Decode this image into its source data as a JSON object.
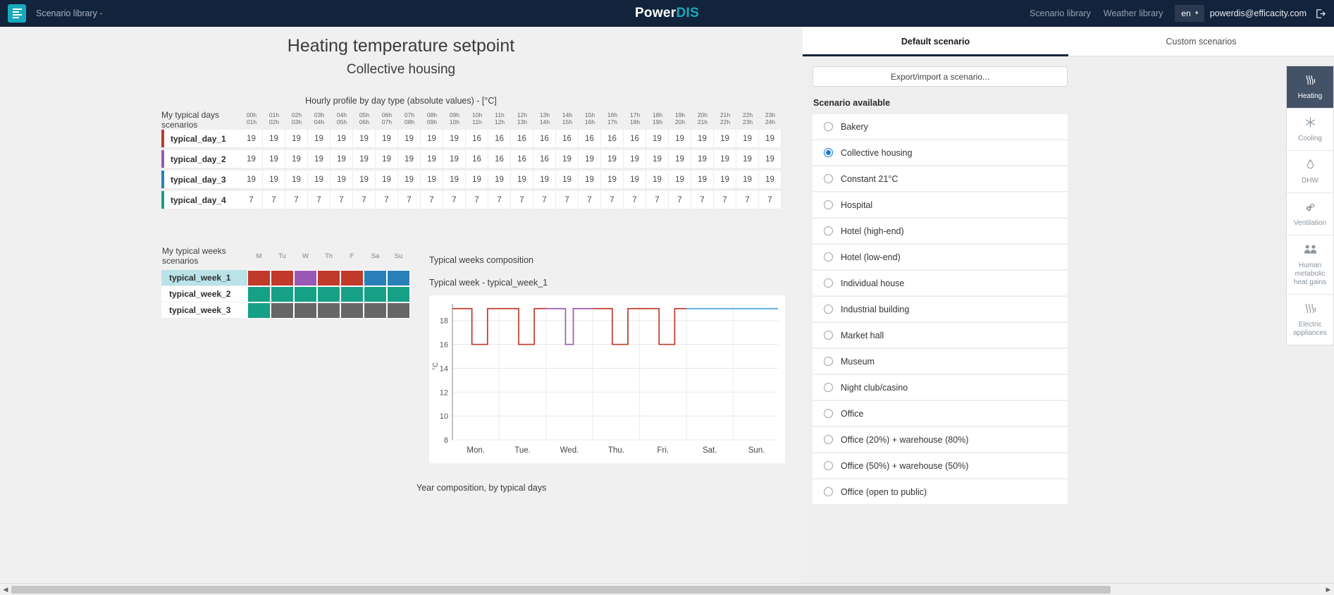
{
  "topbar": {
    "menu_icon": "hamburger-icon",
    "breadcrumb": "Scenario library -",
    "logo_part1": "Power",
    "logo_part2": "DIS",
    "links": [
      "Scenario library",
      "Weather library"
    ],
    "language": "en",
    "user_email": "powerdis@efficacity.com",
    "logout_icon": "logout-icon"
  },
  "main": {
    "title": "Heating temperature setpoint",
    "subtitle": "Collective housing",
    "hourly_title": "Hourly profile by day type (absolute values) - [°C]",
    "days_header_label": "My typical days scenarios",
    "hour_columns": [
      {
        "from": "00h",
        "to": "01h"
      },
      {
        "from": "01h",
        "to": "02h"
      },
      {
        "from": "02h",
        "to": "03h"
      },
      {
        "from": "03h",
        "to": "04h"
      },
      {
        "from": "04h",
        "to": "05h"
      },
      {
        "from": "05h",
        "to": "06h"
      },
      {
        "from": "06h",
        "to": "07h"
      },
      {
        "from": "07h",
        "to": "08h"
      },
      {
        "from": "08h",
        "to": "09h"
      },
      {
        "from": "09h",
        "to": "10h"
      },
      {
        "from": "10h",
        "to": "11h"
      },
      {
        "from": "11h",
        "to": "12h"
      },
      {
        "from": "12h",
        "to": "13h"
      },
      {
        "from": "13h",
        "to": "14h"
      },
      {
        "from": "14h",
        "to": "15h"
      },
      {
        "from": "15h",
        "to": "16h"
      },
      {
        "from": "16h",
        "to": "17h"
      },
      {
        "from": "17h",
        "to": "18h"
      },
      {
        "from": "18h",
        "to": "19h"
      },
      {
        "from": "19h",
        "to": "20h"
      },
      {
        "from": "20h",
        "to": "21h"
      },
      {
        "from": "21h",
        "to": "22h"
      },
      {
        "from": "22h",
        "to": "23h"
      },
      {
        "from": "23h",
        "to": "24h"
      }
    ],
    "day_rows": [
      {
        "name": "typical_day_1",
        "color": "#c0392b",
        "values": [
          19,
          19,
          19,
          19,
          19,
          19,
          19,
          19,
          19,
          19,
          16,
          16,
          16,
          16,
          16,
          16,
          16,
          16,
          19,
          19,
          19,
          19,
          19,
          19
        ]
      },
      {
        "name": "typical_day_2",
        "color": "#9b59b6",
        "values": [
          19,
          19,
          19,
          19,
          19,
          19,
          19,
          19,
          19,
          19,
          16,
          16,
          16,
          16,
          19,
          19,
          19,
          19,
          19,
          19,
          19,
          19,
          19,
          19
        ]
      },
      {
        "name": "typical_day_3",
        "color": "#2980b9",
        "values": [
          19,
          19,
          19,
          19,
          19,
          19,
          19,
          19,
          19,
          19,
          19,
          19,
          19,
          19,
          19,
          19,
          19,
          19,
          19,
          19,
          19,
          19,
          19,
          19
        ]
      },
      {
        "name": "typical_day_4",
        "color": "#16a085",
        "values": [
          7,
          7,
          7,
          7,
          7,
          7,
          7,
          7,
          7,
          7,
          7,
          7,
          7,
          7,
          7,
          7,
          7,
          7,
          7,
          7,
          7,
          7,
          7,
          7
        ]
      }
    ],
    "weeks_header_label": "My typical weeks scenarios",
    "dow_headers": [
      "M",
      "Tu",
      "W",
      "Th",
      "F",
      "Sa",
      "Su"
    ],
    "week_rows": [
      {
        "name": "typical_week_1",
        "selected": true,
        "colors": [
          "#c0392b",
          "#c0392b",
          "#9b59b6",
          "#c0392b",
          "#c0392b",
          "#2980b9",
          "#2980b9"
        ]
      },
      {
        "name": "typical_week_2",
        "selected": false,
        "colors": [
          "#16a085",
          "#16a085",
          "#16a085",
          "#16a085",
          "#16a085",
          "#16a085",
          "#16a085"
        ]
      },
      {
        "name": "typical_week_3",
        "selected": false,
        "colors": [
          "#16a085",
          "#666666",
          "#666666",
          "#666666",
          "#666666",
          "#666666",
          "#666666"
        ]
      }
    ],
    "weeks_composition_title": "Typical weeks composition",
    "chart_caption": "Typical week - typical_week_1",
    "year_composition_title": "Year composition, by typical days"
  },
  "chart_data": {
    "type": "line",
    "title": "Typical week - typical_week_1",
    "xlabel": "",
    "ylabel": "°C",
    "ylim": [
      8,
      19.4
    ],
    "yticks": [
      8,
      10,
      12,
      14,
      16,
      18
    ],
    "xticks": [
      "Mon.",
      "Tue.",
      "Wed.",
      "Thu.",
      "Fri.",
      "Sat.",
      "Sun."
    ],
    "grid": true,
    "legend": "none",
    "series": [
      {
        "name": "typical_day_1",
        "color": "#c0392b",
        "days": [
          "Mon.",
          "Tue.",
          "Thu.",
          "Fri."
        ],
        "hourly": [
          19,
          19,
          19,
          19,
          19,
          19,
          19,
          19,
          19,
          19,
          16,
          16,
          16,
          16,
          16,
          16,
          16,
          16,
          19,
          19,
          19,
          19,
          19,
          19
        ]
      },
      {
        "name": "typical_day_2",
        "color": "#9b59b6",
        "days": [
          "Wed."
        ],
        "hourly": [
          19,
          19,
          19,
          19,
          19,
          19,
          19,
          19,
          19,
          19,
          16,
          16,
          16,
          16,
          19,
          19,
          19,
          19,
          19,
          19,
          19,
          19,
          19,
          19
        ]
      },
      {
        "name": "typical_day_3",
        "color": "#4aa3df",
        "days": [
          "Sat.",
          "Sun."
        ],
        "hourly": [
          19,
          19,
          19,
          19,
          19,
          19,
          19,
          19,
          19,
          19,
          19,
          19,
          19,
          19,
          19,
          19,
          19,
          19,
          19,
          19,
          19,
          19,
          19,
          19
        ]
      }
    ]
  },
  "right_panel": {
    "tabs": [
      {
        "label": "Default scenario",
        "active": true
      },
      {
        "label": "Custom scenarios",
        "active": false
      }
    ],
    "export_button": "Export/import a scenario...",
    "available_label": "Scenario available",
    "scenarios": [
      {
        "label": "Bakery",
        "selected": false
      },
      {
        "label": "Collective housing",
        "selected": true
      },
      {
        "label": "Constant 21°C",
        "selected": false
      },
      {
        "label": "Hospital",
        "selected": false
      },
      {
        "label": "Hotel (high-end)",
        "selected": false
      },
      {
        "label": "Hotel (low-end)",
        "selected": false
      },
      {
        "label": "Individual house",
        "selected": false
      },
      {
        "label": "Industrial building",
        "selected": false
      },
      {
        "label": "Market hall",
        "selected": false
      },
      {
        "label": "Museum",
        "selected": false
      },
      {
        "label": "Night club/casino",
        "selected": false
      },
      {
        "label": "Office",
        "selected": false
      },
      {
        "label": "Office (20&#37;) + warehouse (80&#37;)",
        "selected": false
      },
      {
        "label": "Office (50&#37;) + warehouse (50&#37;)",
        "selected": false
      },
      {
        "label": "Office (open to public)",
        "selected": false
      }
    ],
    "rail": [
      {
        "label": "Heating",
        "icon": "heat-waves-icon",
        "glyph": "⸼",
        "active": true
      },
      {
        "label": "Cooling",
        "icon": "snowflake-icon",
        "glyph": "✱",
        "active": false
      },
      {
        "label": "DHW",
        "icon": "water-drop-icon",
        "glyph": "◊",
        "active": false
      },
      {
        "label": "Ventilation",
        "icon": "fan-icon",
        "glyph": "✸",
        "active": false
      },
      {
        "label": "Human metabolic heat gains",
        "icon": "people-icon",
        "glyph": "὆5",
        "active": false
      },
      {
        "label": "Electric appliances",
        "icon": "plug-icon",
        "glyph": "⸼",
        "active": false
      }
    ]
  }
}
